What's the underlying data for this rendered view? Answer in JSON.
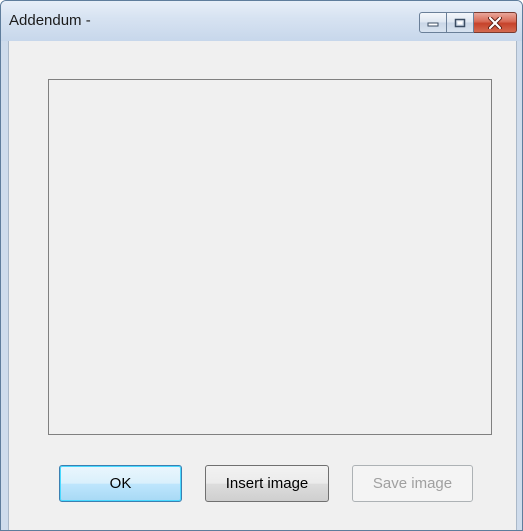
{
  "window": {
    "title": "Addendum -"
  },
  "caption_buttons": {
    "minimize_icon": "minimize-icon",
    "maximize_icon": "maximize-icon",
    "close_icon": "close-icon"
  },
  "buttons": {
    "ok_label": "OK",
    "insert_image_label": "Insert image",
    "save_image_label": "Save image",
    "save_image_enabled": false
  },
  "colors": {
    "ok_accent": "#3c7fb1",
    "close_button": "#c6422a",
    "titlebar": "#d6e2f1"
  }
}
